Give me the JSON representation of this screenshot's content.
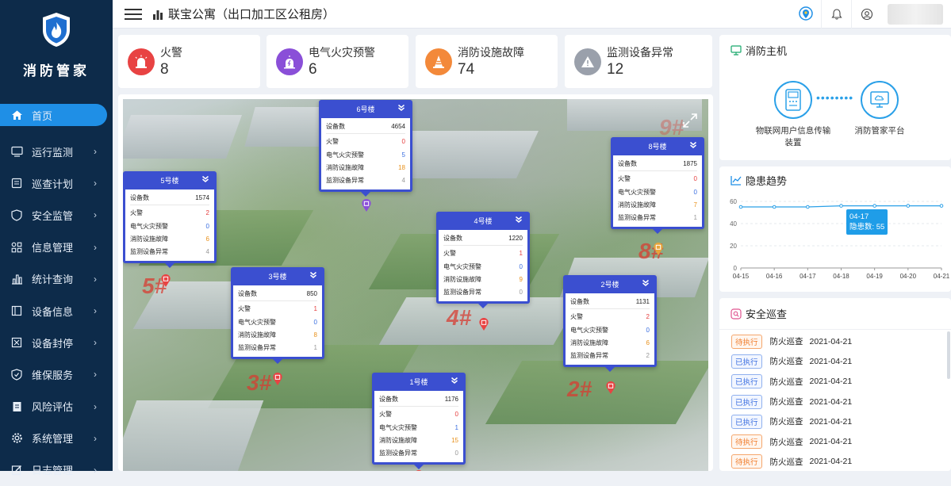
{
  "sidebar": {
    "app_name": "消防管家",
    "items": [
      {
        "label": "首页",
        "icon": "home-icon"
      },
      {
        "label": "运行监测",
        "icon": "monitor-icon"
      },
      {
        "label": "巡查计划",
        "icon": "calendar-icon"
      },
      {
        "label": "安全监管",
        "icon": "shield-icon"
      },
      {
        "label": "信息管理",
        "icon": "grid-icon"
      },
      {
        "label": "统计查询",
        "icon": "bar-chart-icon"
      },
      {
        "label": "设备信息",
        "icon": "device-icon"
      },
      {
        "label": "设备封停",
        "icon": "block-icon"
      },
      {
        "label": "维保服务",
        "icon": "check-shield-icon"
      },
      {
        "label": "风险评估",
        "icon": "document-icon"
      },
      {
        "label": "系统管理",
        "icon": "gear-icon"
      },
      {
        "label": "日志管理",
        "icon": "edit-icon"
      }
    ]
  },
  "header": {
    "title": "联宝公寓（出口加工区公租房）"
  },
  "stats": [
    {
      "label": "火警",
      "value": "8",
      "color": "#e84343"
    },
    {
      "label": "电气火灾预警",
      "value": "6",
      "color": "#8a4fd8"
    },
    {
      "label": "消防设施故障",
      "value": "74",
      "color": "#f3893a"
    },
    {
      "label": "监测设备异常",
      "value": "12",
      "color": "#9aa0ab"
    }
  ],
  "map": {
    "row_labels": {
      "devices": "设备数",
      "fire": "火警",
      "electric": "电气火灾预警",
      "facility": "消防设施故障",
      "monitor": "监测设备异常"
    },
    "buildings": [
      {
        "name": "6号楼",
        "devices": "4654",
        "fire": "0",
        "electric": "5",
        "facility": "18",
        "monitor": "4"
      },
      {
        "name": "5号楼",
        "devices": "1574",
        "fire": "2",
        "electric": "0",
        "facility": "6",
        "monitor": "4"
      },
      {
        "name": "8号楼",
        "devices": "1875",
        "fire": "0",
        "electric": "0",
        "facility": "7",
        "monitor": "1"
      },
      {
        "name": "4号楼",
        "devices": "1220",
        "fire": "1",
        "electric": "0",
        "facility": "9",
        "monitor": "0"
      },
      {
        "name": "3号楼",
        "devices": "850",
        "fire": "1",
        "electric": "0",
        "facility": "8",
        "monitor": "1"
      },
      {
        "name": "2号楼",
        "devices": "1131",
        "fire": "2",
        "electric": "0",
        "facility": "6",
        "monitor": "2"
      },
      {
        "name": "1号楼",
        "devices": "1176",
        "fire": "0",
        "electric": "1",
        "facility": "15",
        "monitor": "0"
      }
    ],
    "marks": [
      "9#",
      "8#",
      "5#",
      "4#",
      "3#",
      "2#"
    ]
  },
  "control_host": {
    "title": "消防主机",
    "device_a": "物联网用户信息传输装置",
    "device_b": "消防管家平台"
  },
  "trend": {
    "title": "隐患趋势",
    "tooltip_date": "04-17",
    "tooltip_value": "隐患数: 55"
  },
  "chart_data": {
    "type": "line",
    "title": "隐患趋势",
    "x": [
      "04-15",
      "04-16",
      "04-17",
      "04-18",
      "04-19",
      "04-20",
      "04-21"
    ],
    "series": [
      {
        "values": [
          55,
          55,
          55,
          56,
          56,
          56,
          56
        ]
      }
    ],
    "ylim": [
      0,
      60
    ],
    "yticks": [
      0,
      20,
      40,
      60
    ]
  },
  "patrol": {
    "title": "安全巡查",
    "rows": [
      {
        "status": "待执行",
        "state": "pending",
        "name": "防火巡查",
        "date": "2021-04-21"
      },
      {
        "status": "已执行",
        "state": "done",
        "name": "防火巡查",
        "date": "2021-04-21"
      },
      {
        "status": "已执行",
        "state": "done",
        "name": "防火巡查",
        "date": "2021-04-21"
      },
      {
        "status": "已执行",
        "state": "done",
        "name": "防火巡查",
        "date": "2021-04-21"
      },
      {
        "status": "已执行",
        "state": "done",
        "name": "防火巡查",
        "date": "2021-04-21"
      },
      {
        "status": "待执行",
        "state": "pending",
        "name": "防火巡查",
        "date": "2021-04-21"
      },
      {
        "status": "待执行",
        "state": "pending",
        "name": "防火巡查",
        "date": "2021-04-21"
      }
    ]
  }
}
